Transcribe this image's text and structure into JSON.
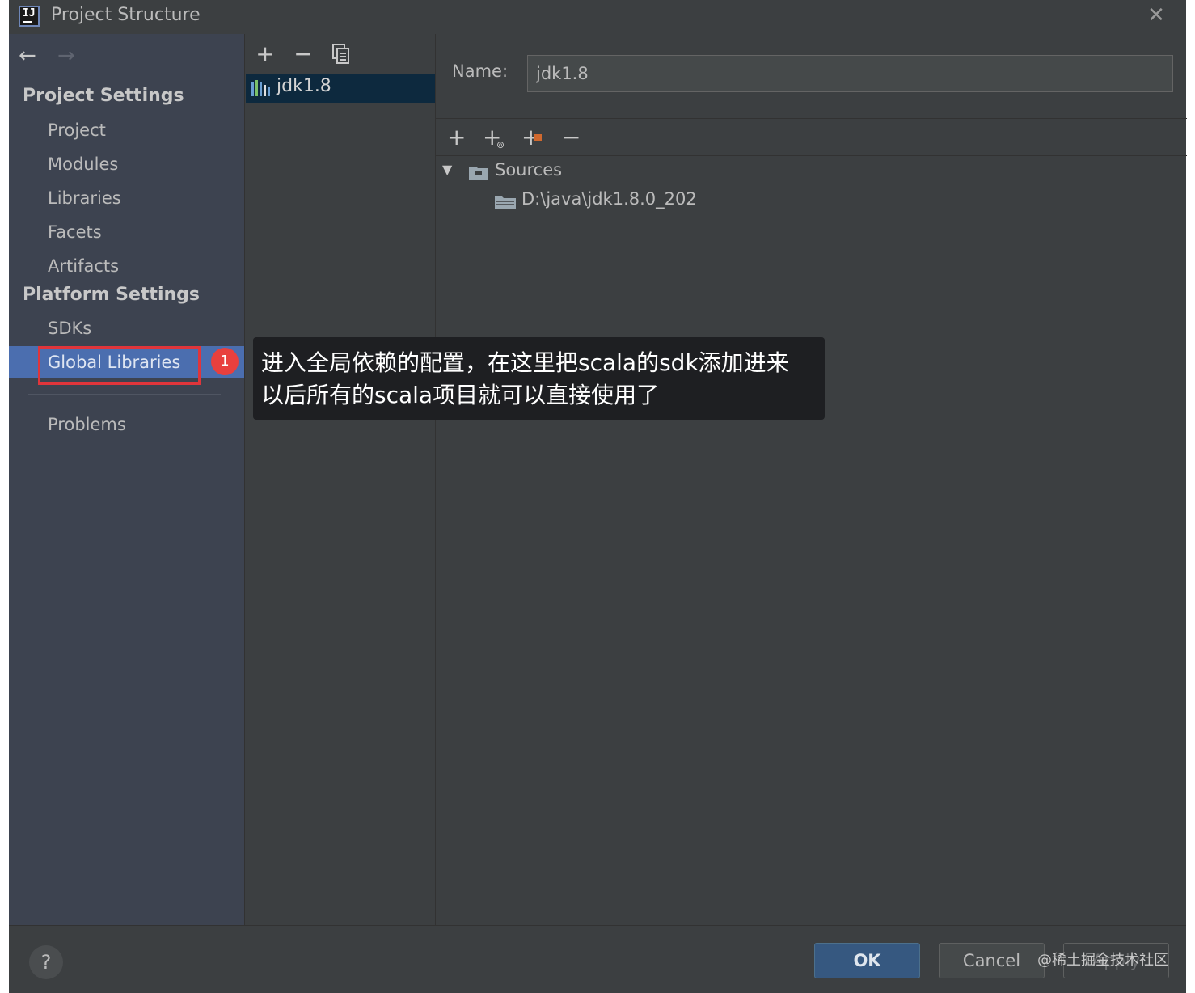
{
  "window": {
    "title": "Project Structure"
  },
  "nav": {
    "sections": [
      {
        "title": "Project Settings",
        "items": [
          "Project",
          "Modules",
          "Libraries",
          "Facets",
          "Artifacts"
        ]
      },
      {
        "title": "Platform Settings",
        "items": [
          "SDKs",
          "Global Libraries"
        ]
      }
    ],
    "selected": "Global Libraries",
    "problems": "Problems",
    "badge": "1"
  },
  "sdk_list": {
    "items": [
      {
        "label": "jdk1.8",
        "selected": true
      }
    ]
  },
  "detail": {
    "name_label": "Name:",
    "name_value": "jdk1.8",
    "tree": {
      "root": "Sources",
      "children": [
        "D:\\java\\jdk1.8.0_202"
      ]
    }
  },
  "tooltip": {
    "line1": "进入全局依赖的配置，在这里把scala的sdk添加进来",
    "line2": "以后所有的scala项目就可以直接使用了"
  },
  "footer": {
    "help": "?",
    "ok": "OK",
    "cancel": "Cancel",
    "apply": "Apply"
  },
  "watermark": "@稀土掘金技术社区",
  "colors": {
    "selection": "#4b6eaf",
    "highlight_box": "#e0353b",
    "badge": "#e8403e",
    "ok_button": "#365880"
  }
}
